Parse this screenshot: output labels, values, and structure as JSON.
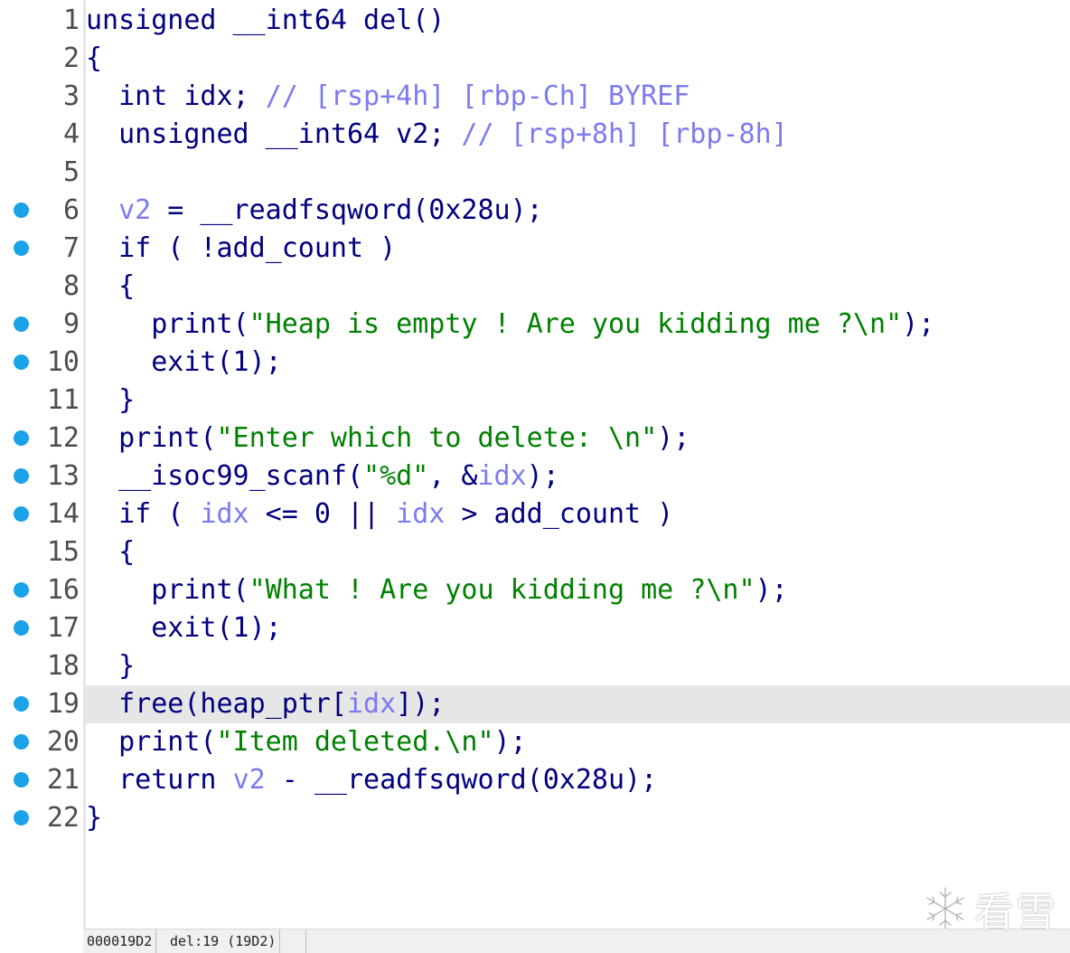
{
  "editor": {
    "highlighted_line": 19,
    "colors": {
      "keyword": "#000080",
      "variable": "#7b7bf0",
      "string": "#008000",
      "breakpoint": "#1aa3e8",
      "line_number": "#4d4d4d",
      "highlight": "#e6e6e6"
    },
    "lines": [
      {
        "num": "1",
        "bp": false,
        "tokens": [
          {
            "t": "unsigned __int64 del()",
            "c": "def"
          }
        ]
      },
      {
        "num": "2",
        "bp": false,
        "tokens": [
          {
            "t": "{",
            "c": "def"
          }
        ]
      },
      {
        "num": "3",
        "bp": false,
        "tokens": [
          {
            "t": "  int idx; ",
            "c": "def"
          },
          {
            "t": "// [rsp+4h] [rbp-Ch] BYREF",
            "c": "var"
          }
        ]
      },
      {
        "num": "4",
        "bp": false,
        "tokens": [
          {
            "t": "  unsigned __int64 v2; ",
            "c": "def"
          },
          {
            "t": "// [rsp+8h] [rbp-8h]",
            "c": "var"
          }
        ]
      },
      {
        "num": "5",
        "bp": false,
        "tokens": [
          {
            "t": "",
            "c": "def"
          }
        ]
      },
      {
        "num": "6",
        "bp": true,
        "tokens": [
          {
            "t": "  ",
            "c": "def"
          },
          {
            "t": "v2",
            "c": "var"
          },
          {
            "t": " = __readfsqword(0x28u);",
            "c": "def"
          }
        ]
      },
      {
        "num": "7",
        "bp": true,
        "tokens": [
          {
            "t": "  if ( !add_count )",
            "c": "def"
          }
        ]
      },
      {
        "num": "8",
        "bp": false,
        "tokens": [
          {
            "t": "  {",
            "c": "def"
          }
        ]
      },
      {
        "num": "9",
        "bp": true,
        "tokens": [
          {
            "t": "    print(",
            "c": "def"
          },
          {
            "t": "\"Heap is empty ! Are you kidding me ?\\n\"",
            "c": "str"
          },
          {
            "t": ");",
            "c": "def"
          }
        ]
      },
      {
        "num": "10",
        "bp": true,
        "tokens": [
          {
            "t": "    exit(1);",
            "c": "def"
          }
        ]
      },
      {
        "num": "11",
        "bp": false,
        "tokens": [
          {
            "t": "  }",
            "c": "def"
          }
        ]
      },
      {
        "num": "12",
        "bp": true,
        "tokens": [
          {
            "t": "  print(",
            "c": "def"
          },
          {
            "t": "\"Enter which to delete: \\n\"",
            "c": "str"
          },
          {
            "t": ");",
            "c": "def"
          }
        ]
      },
      {
        "num": "13",
        "bp": true,
        "tokens": [
          {
            "t": "  __isoc99_scanf(",
            "c": "def"
          },
          {
            "t": "\"%d\"",
            "c": "str"
          },
          {
            "t": ", &",
            "c": "def"
          },
          {
            "t": "idx",
            "c": "var"
          },
          {
            "t": ");",
            "c": "def"
          }
        ]
      },
      {
        "num": "14",
        "bp": true,
        "tokens": [
          {
            "t": "  if ( ",
            "c": "def"
          },
          {
            "t": "idx",
            "c": "var"
          },
          {
            "t": " <= 0 || ",
            "c": "def"
          },
          {
            "t": "idx",
            "c": "var"
          },
          {
            "t": " > add_count )",
            "c": "def"
          }
        ]
      },
      {
        "num": "15",
        "bp": false,
        "tokens": [
          {
            "t": "  {",
            "c": "def"
          }
        ]
      },
      {
        "num": "16",
        "bp": true,
        "tokens": [
          {
            "t": "    print(",
            "c": "def"
          },
          {
            "t": "\"What ! Are you kidding me ?\\n\"",
            "c": "str"
          },
          {
            "t": ");",
            "c": "def"
          }
        ]
      },
      {
        "num": "17",
        "bp": true,
        "tokens": [
          {
            "t": "    exit(1);",
            "c": "def"
          }
        ]
      },
      {
        "num": "18",
        "bp": false,
        "tokens": [
          {
            "t": "  }",
            "c": "def"
          }
        ]
      },
      {
        "num": "19",
        "bp": true,
        "tokens": [
          {
            "t": "  free(heap_ptr[",
            "c": "def"
          },
          {
            "t": "idx",
            "c": "var"
          },
          {
            "t": "]);",
            "c": "def"
          }
        ]
      },
      {
        "num": "20",
        "bp": true,
        "tokens": [
          {
            "t": "  print(",
            "c": "def"
          },
          {
            "t": "\"Item deleted.\\n\"",
            "c": "str"
          },
          {
            "t": ");",
            "c": "def"
          }
        ]
      },
      {
        "num": "21",
        "bp": true,
        "tokens": [
          {
            "t": "  return ",
            "c": "def"
          },
          {
            "t": "v2",
            "c": "var"
          },
          {
            "t": " - __readfsqword(0x28u);",
            "c": "def"
          }
        ]
      },
      {
        "num": "22",
        "bp": true,
        "tokens": [
          {
            "t": "}",
            "c": "def"
          }
        ]
      }
    ]
  },
  "status_bar": {
    "address": "000019D2",
    "location": "del:19 (19D2)"
  },
  "watermark": {
    "icon": "snowflake-icon",
    "text": "看雪"
  }
}
